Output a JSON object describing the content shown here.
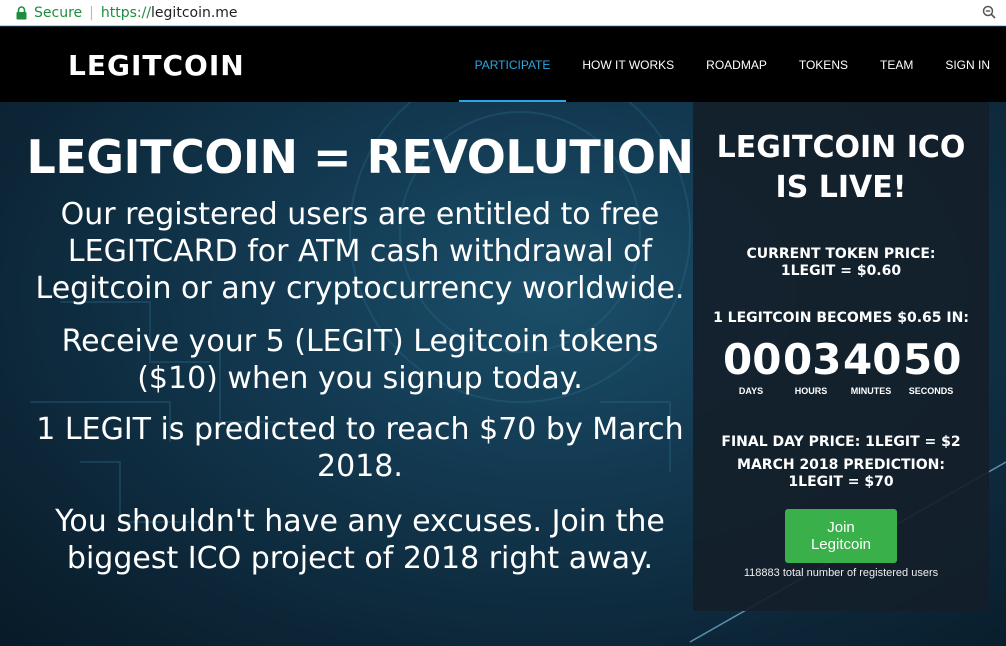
{
  "browser": {
    "secure_label": "Secure",
    "url_scheme": "https://",
    "url_host": "legitcoin.me"
  },
  "header": {
    "logo": "LEGITCOIN",
    "nav": [
      {
        "label": "PARTICIPATE",
        "active": true
      },
      {
        "label": "HOW IT WORKS",
        "active": false
      },
      {
        "label": "ROADMAP",
        "active": false
      },
      {
        "label": "TOKENS",
        "active": false
      },
      {
        "label": "TEAM",
        "active": false
      },
      {
        "label": "SIGN IN",
        "active": false
      }
    ],
    "accent": "#2aa7e0"
  },
  "hero": {
    "headline": "LEGITCOIN = REVOLUTION",
    "paragraphs": [
      "Our registered users are entitled to free LEGITCARD for ATM cash withdrawal of Legitcoin or any cryptocurrency worldwide.",
      "Receive your 5 (LEGIT) Legitcoin tokens ($10) when you signup today.",
      "1 LEGIT is predicted to reach $70 by March 2018.",
      "You shouldn't have any excuses. Join the biggest ICO project of 2018 right away."
    ]
  },
  "panel": {
    "title_line1": "LEGITCOIN ICO",
    "title_line2": "IS LIVE!",
    "price_line1": "CURRENT TOKEN PRICE:",
    "price_line2": "1LEGIT = $0.60",
    "becomes": "1 LEGITCOIN BECOMES $0.65 IN:",
    "countdown": [
      {
        "value": "00",
        "unit": "DAYS"
      },
      {
        "value": "03",
        "unit": "HOURS"
      },
      {
        "value": "40",
        "unit": "MINUTES"
      },
      {
        "value": "50",
        "unit": "SECONDS"
      }
    ],
    "final_price": "FINAL DAY PRICE: 1LEGIT = $2",
    "prediction_line1": "MARCH 2018 PREDICTION:",
    "prediction_line2": "1LEGIT = $70",
    "join_button": "Join Legitcoin",
    "users_text": "118883 total number of registered users",
    "button_color": "#3ab04a"
  }
}
